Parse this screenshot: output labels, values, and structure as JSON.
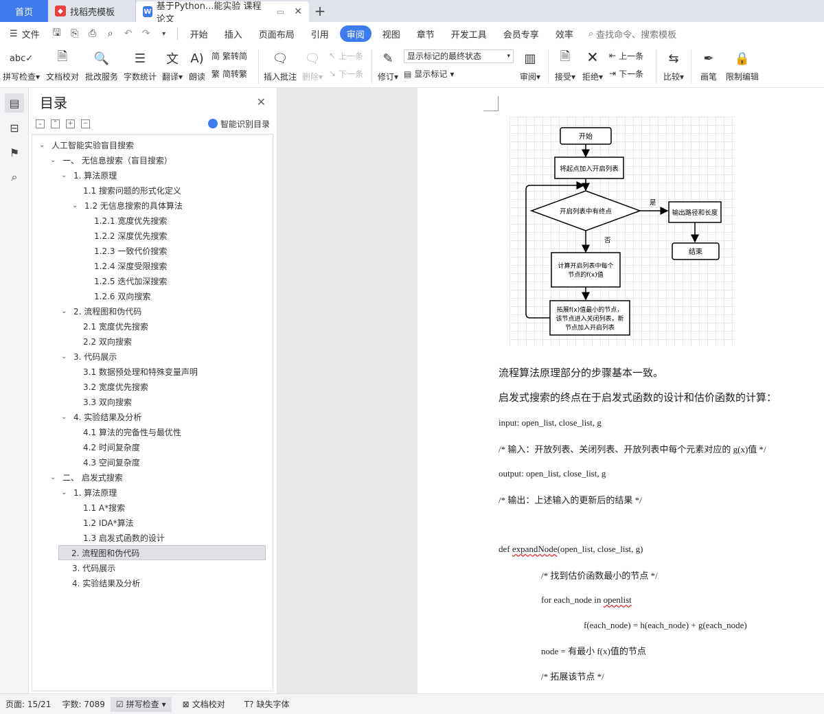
{
  "tabs": {
    "home": "首页",
    "template": "找稻壳模板",
    "doc": "基于Python...能实验 课程论文"
  },
  "menu": {
    "file": "文件",
    "items": [
      "开始",
      "插入",
      "页面布局",
      "引用",
      "审阅",
      "视图",
      "章节",
      "开发工具",
      "会员专享",
      "效率"
    ],
    "active": "审阅",
    "search": "查找命令、搜索模板"
  },
  "ribbon": {
    "spell": "拼写检查",
    "proof": "文档校对",
    "review_service": "批改服务",
    "word_count": "字数统计",
    "translate": "翻译",
    "read": "朗读",
    "trad": "繁转简",
    "simp": "简转繁",
    "insert_comment": "插入批注",
    "delete": "删除",
    "prev": "上一条",
    "next": "下一条",
    "revise": "修订",
    "markup_state": "显示标记的最终状态",
    "show_markup": "显示标记",
    "review": "审阅",
    "accept": "接受",
    "reject": "拒绝",
    "prev2": "上一条",
    "next2": "下一条",
    "compare": "比较",
    "pen": "画笔",
    "restrict": "限制编辑"
  },
  "toc": {
    "title": "目录",
    "smart": "智能识别目录",
    "items": [
      {
        "t": "人工智能实验盲目搜索"
      },
      {
        "t": "一、  无信息搜索（盲目搜索）"
      },
      {
        "t": "1. 算法原理"
      },
      {
        "t": "1.1  搜索问题的形式化定义"
      },
      {
        "t": "1.2  无信息搜索的具体算法"
      },
      {
        "t": "1.2.1  宽度优先搜索"
      },
      {
        "t": "1.2.2  深度优先搜索"
      },
      {
        "t": "1.2.3  一致代价搜索"
      },
      {
        "t": "1.2.4  深度受限搜索"
      },
      {
        "t": "1.2.5  迭代加深搜索"
      },
      {
        "t": "1.2.6  双向搜索"
      },
      {
        "t": "2. 流程图和伪代码"
      },
      {
        "t": "2.1  宽度优先搜索"
      },
      {
        "t": "2.2  双向搜索"
      },
      {
        "t": "3. 代码展示"
      },
      {
        "t": "3.1  数据预处理和特殊变量声明"
      },
      {
        "t": "3.2  宽度优先搜索"
      },
      {
        "t": "3.3  双向搜索"
      },
      {
        "t": "4. 实验结果及分析"
      },
      {
        "t": "4.1  算法的完备性与最优性"
      },
      {
        "t": "4.2  时间复杂度"
      },
      {
        "t": "4.3  空间复杂度"
      },
      {
        "t": "二、  启发式搜索"
      },
      {
        "t": "1. 算法原理"
      },
      {
        "t": "1.1 A*搜索"
      },
      {
        "t": "1.2 IDA*算法"
      },
      {
        "t": "1.3  启发式函数的设计"
      },
      {
        "t": "2. 流程图和伪代码"
      },
      {
        "t": "3. 代码展示"
      },
      {
        "t": "4. 实验结果及分析"
      }
    ]
  },
  "flowchart": {
    "start": "开始",
    "add_open": "将起点加入开启列表",
    "decision": "开启列表中有终点",
    "yes": "是",
    "no": "否",
    "output": "输出路径和长度",
    "end": "结束",
    "calc_l1": "计算开启列表中每个",
    "calc_l2": "节点的f(x)值",
    "expand_l1": "拓展f(x)值最小的节点，",
    "expand_l2": "该节点进入关闭列表，新",
    "expand_l3": "节点加入开启列表"
  },
  "doc": {
    "p1": "流程算法原理部分的步骤基本一致。",
    "p2": "启发式搜索的终点在于启发式函数的设计和估价函数的计算：",
    "c1": "input: open_list, close_list, g",
    "c2": "/*  输入：开放列表、关闭列表、开放列表中每个元素对应的 g(x)值  */",
    "c3": "output: open_list, close_list, g",
    "c4": "/*  输出：上述输入的更新后的结果  */",
    "c5a": "def ",
    "c5b": "expandNode",
    "c5c": "(open_list, close_list, g)",
    "c6": "/*  找到估价函数最小的节点  */",
    "c7a": "for each_node in ",
    "c7b": "openlist",
    "c8": "f(each_node) = h(each_node) + g(each_node)",
    "c9": "node =  有最小 f(x)值的节点",
    "c10": "/*  拓展该节点  */"
  },
  "status": {
    "page": "页面: 15/21",
    "words": "字数: 7089",
    "spell": "拼写检查",
    "proof": "文档校对",
    "missing_font": "缺失字体"
  }
}
